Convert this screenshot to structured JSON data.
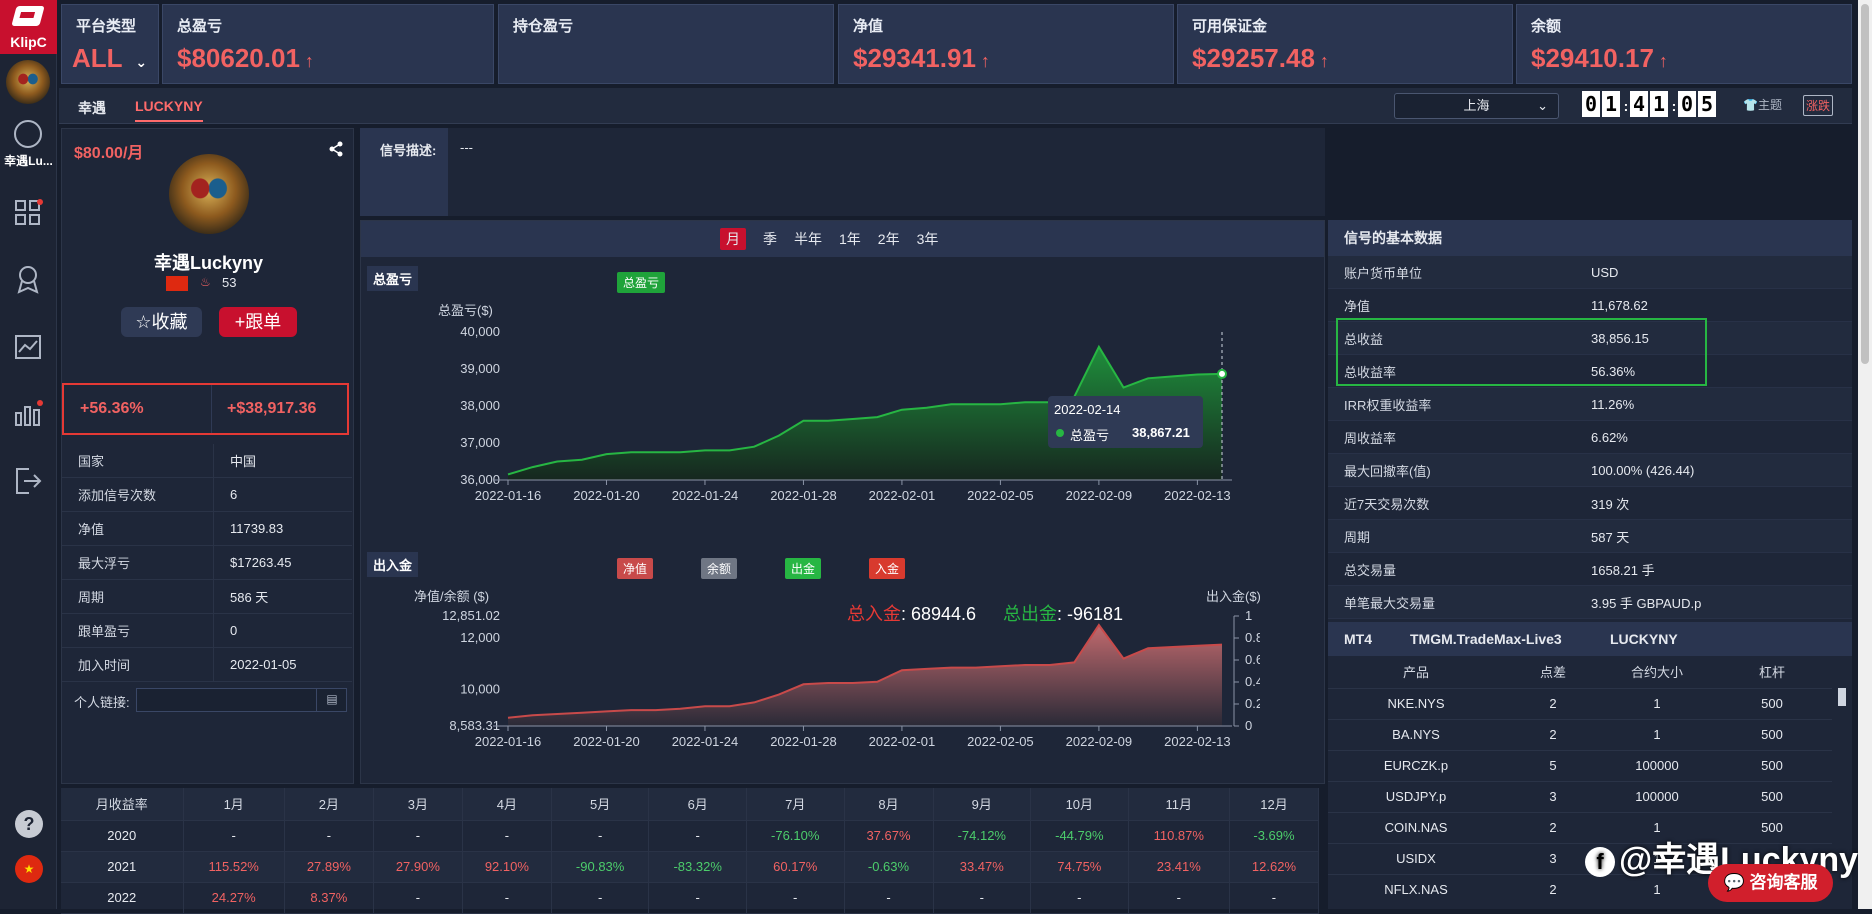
{
  "brand": {
    "logo_text": "KlipC"
  },
  "sidebar": {
    "user_label": "幸遇Lu...",
    "help_icon": "question-icon"
  },
  "top_cards": [
    {
      "label": "平台类型",
      "value": "ALL"
    },
    {
      "label": "总盈亏",
      "value": "$80620.01"
    },
    {
      "label": "持仓盈亏",
      "value": ""
    },
    {
      "label": "净值",
      "value": "$29341.91"
    },
    {
      "label": "可用保证金",
      "value": "$29257.48"
    },
    {
      "label": "余额",
      "value": "$29410.17"
    }
  ],
  "tabs": [
    {
      "label": "幸遇"
    },
    {
      "label": "LUCKYNY"
    }
  ],
  "header_right": {
    "city": "上海",
    "clock": [
      "0",
      "1",
      "4",
      "1",
      "0",
      "5"
    ],
    "theme_label": "主题",
    "updown_label": "涨跌"
  },
  "profile": {
    "price": "$80.00/月",
    "name": "幸遇Luckyny",
    "score": "53",
    "fav_label": "☆收藏",
    "follow_label": "+跟单",
    "return_rate": "+56.36%",
    "profit": "+$38,917.36",
    "rows": [
      {
        "k": "国家",
        "v": "中国"
      },
      {
        "k": "添加信号次数",
        "v": "6"
      },
      {
        "k": "净值",
        "v": "11739.83"
      },
      {
        "k": "最大浮亏",
        "v": "$17263.45"
      },
      {
        "k": "周期",
        "v": "586 天"
      },
      {
        "k": "跟单盈亏",
        "v": "0"
      },
      {
        "k": "加入时间",
        "v": "2022-01-05"
      }
    ],
    "link_label": "个人链接:"
  },
  "signal": {
    "desc_label": "信号描述:",
    "desc_value": "---"
  },
  "periods": [
    "月",
    "季",
    "半年",
    "1年",
    "2年",
    "3年"
  ],
  "chart_data": [
    {
      "type": "area",
      "title": "总盈亏",
      "ylabel": "总盈亏($)",
      "series": [
        {
          "name": "总盈亏"
        }
      ],
      "x": [
        "2022-01-16",
        "2022-01-17",
        "2022-01-18",
        "2022-01-19",
        "2022-01-20",
        "2022-01-21",
        "2022-01-22",
        "2022-01-23",
        "2022-01-24",
        "2022-01-25",
        "2022-01-26",
        "2022-01-27",
        "2022-01-28",
        "2022-01-29",
        "2022-01-30",
        "2022-01-31",
        "2022-02-01",
        "2022-02-02",
        "2022-02-03",
        "2022-02-04",
        "2022-02-05",
        "2022-02-06",
        "2022-02-07",
        "2022-02-08",
        "2022-02-09",
        "2022-02-10",
        "2022-02-11",
        "2022-02-12",
        "2022-02-13",
        "2022-02-14"
      ],
      "y": [
        36150,
        36350,
        36500,
        36550,
        36700,
        36750,
        36750,
        36750,
        36800,
        36800,
        36900,
        37200,
        37600,
        37600,
        37650,
        37700,
        37900,
        37950,
        38050,
        38050,
        38050,
        38100,
        38100,
        38250,
        39600,
        38500,
        38750,
        38800,
        38850,
        38867.21
      ],
      "xticks": [
        "2022-01-16",
        "2022-01-20",
        "2022-01-24",
        "2022-01-28",
        "2022-02-01",
        "2022-02-05",
        "2022-02-09",
        "2022-02-13"
      ],
      "yticks": [
        "40,000",
        "39,000",
        "38,000",
        "37,000",
        "36,000"
      ],
      "ylim": [
        36000,
        40000
      ],
      "tooltip": {
        "date": "2022-02-14",
        "label": "总盈亏",
        "value": "38,867.21"
      }
    },
    {
      "type": "area",
      "title": "出入金",
      "ylabel": "净值/余额 ($)",
      "y2label": "出入金($)",
      "legend": [
        "净值",
        "余额",
        "出金",
        "入金"
      ],
      "x": [
        "2022-01-16",
        "2022-01-17",
        "2022-01-18",
        "2022-01-19",
        "2022-01-20",
        "2022-01-21",
        "2022-01-22",
        "2022-01-23",
        "2022-01-24",
        "2022-01-25",
        "2022-01-26",
        "2022-01-27",
        "2022-01-28",
        "2022-01-29",
        "2022-01-30",
        "2022-01-31",
        "2022-02-01",
        "2022-02-02",
        "2022-02-03",
        "2022-02-04",
        "2022-02-05",
        "2022-02-06",
        "2022-02-07",
        "2022-02-08",
        "2022-02-09",
        "2022-02-10",
        "2022-02-11",
        "2022-02-12",
        "2022-02-13",
        "2022-02-14"
      ],
      "y": [
        8900,
        9000,
        9050,
        9100,
        9150,
        9200,
        9200,
        9250,
        9350,
        9350,
        9500,
        9800,
        10200,
        10250,
        10250,
        10300,
        10750,
        10800,
        10850,
        10850,
        10900,
        10950,
        10950,
        11050,
        12500,
        11200,
        11600,
        11650,
        11700,
        11740
      ],
      "ylim": [
        8583.31,
        12851.02
      ],
      "yticks": [
        "12,851.02",
        "12,000",
        "10,000",
        "8,583.31"
      ],
      "y2ticks": [
        "1",
        "0.8",
        "0.6",
        "0.4",
        "0.2",
        "0"
      ],
      "xticks": [
        "2022-01-16",
        "2022-01-20",
        "2022-01-24",
        "2022-01-28",
        "2022-02-01",
        "2022-02-05",
        "2022-02-09",
        "2022-02-13"
      ],
      "deposit_label": "总入金",
      "deposit_value": ": 68944.6",
      "withdraw_label": "总出金",
      "withdraw_value": ": -96181"
    }
  ],
  "basic": {
    "title": "信号的基本数据",
    "rows": [
      {
        "k": "账户货币单位",
        "v": "USD"
      },
      {
        "k": "净值",
        "v": "11,678.62"
      },
      {
        "k": "总收益",
        "v": "38,856.15"
      },
      {
        "k": "总收益率",
        "v": "56.36%"
      },
      {
        "k": "IRR权重收益率",
        "v": "11.26%"
      },
      {
        "k": "周收益率",
        "v": "6.62%"
      },
      {
        "k": "最大回撤率(值)",
        "v": "100.00% (426.44)"
      },
      {
        "k": "近7天交易次数",
        "v": "319 次"
      },
      {
        "k": "周期",
        "v": "587 天"
      },
      {
        "k": "总交易量",
        "v": "1658.21 手"
      },
      {
        "k": "单笔最大交易量",
        "v": "3.95 手 GBPAUD.p"
      }
    ]
  },
  "mt4": {
    "platform": "MT4",
    "server": "TMGM.TradeMax-Live3",
    "account": "LUCKYNY",
    "headers": [
      "产品",
      "点差",
      "合约大小",
      "杠杆"
    ],
    "rows": [
      [
        "NKE.NYS",
        "2",
        "1",
        "500"
      ],
      [
        "BA.NYS",
        "2",
        "1",
        "500"
      ],
      [
        "EURCZK.p",
        "5",
        "100000",
        "500"
      ],
      [
        "USDJPY.p",
        "3",
        "100000",
        "500"
      ],
      [
        "COIN.NAS",
        "2",
        "1",
        "500"
      ],
      [
        "USIDX",
        "3",
        "1",
        ""
      ],
      [
        "NFLX.NAS",
        "2",
        "1",
        ""
      ]
    ]
  },
  "monthly": {
    "headers": [
      "月收益率",
      "1月",
      "2月",
      "3月",
      "4月",
      "5月",
      "6月",
      "7月",
      "8月",
      "9月",
      "10月",
      "11月",
      "12月"
    ],
    "rows": [
      [
        "2020",
        "-",
        "-",
        "-",
        "-",
        "-",
        "-",
        "-76.10%",
        "37.67%",
        "-74.12%",
        "-44.79%",
        "110.87%",
        "-3.69%"
      ],
      [
        "2021",
        "115.52%",
        "27.89%",
        "27.90%",
        "92.10%",
        "-90.83%",
        "-83.32%",
        "60.17%",
        "-0.63%",
        "33.47%",
        "74.75%",
        "23.41%",
        "12.62%"
      ],
      [
        "2022",
        "24.27%",
        "8.37%",
        "-",
        "-",
        "-",
        "-",
        "-",
        "-",
        "-",
        "-",
        "-",
        "-"
      ]
    ]
  },
  "consult_label": "咨询客服",
  "watermark": "@幸遇Luckyny",
  "colors": {
    "accent_red": "#f16262",
    "brand_red": "#c8102e",
    "green": "#27b643",
    "panel": "#1e2638"
  }
}
